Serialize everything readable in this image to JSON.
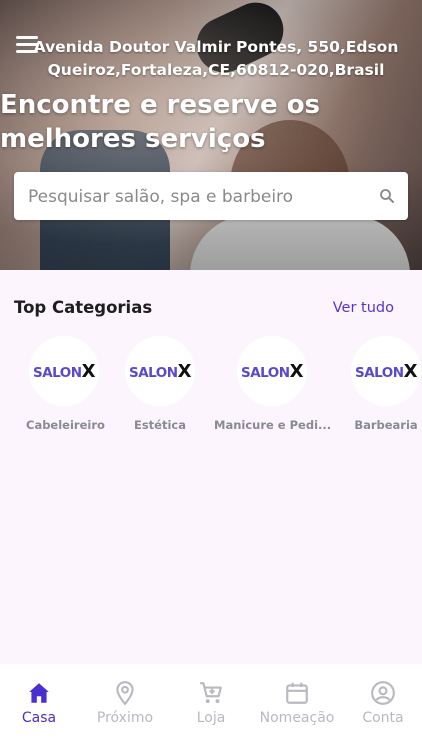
{
  "header": {
    "address": "Avenida Doutor Valmir Pontes, 550,Edson Queiroz,Fortaleza,CE,60812-020,Brasil",
    "headline": "Encontre e reserve os melhores serviços"
  },
  "search": {
    "placeholder": "Pesquisar salão, spa e barbeiro",
    "value": ""
  },
  "categories_section": {
    "title": "Top Categorias",
    "see_all": "Ver tudo",
    "items": [
      {
        "label": "Cabeleireiro",
        "logo_left": "SALON",
        "logo_right": "X"
      },
      {
        "label": "Estética",
        "logo_left": "SALON",
        "logo_right": "X"
      },
      {
        "label": "Manicure e Pedi...",
        "logo_left": "SALON",
        "logo_right": "X"
      },
      {
        "label": "Barbearia",
        "logo_left": "SALON",
        "logo_right": "X"
      }
    ]
  },
  "tabbar": {
    "items": [
      {
        "label": "Casa",
        "icon": "home-icon",
        "active": true
      },
      {
        "label": "Próximo",
        "icon": "location-pin-icon",
        "active": false
      },
      {
        "label": "Loja",
        "icon": "cart-icon",
        "active": false
      },
      {
        "label": "Nomeação",
        "icon": "calendar-icon",
        "active": false
      },
      {
        "label": "Conta",
        "icon": "account-icon",
        "active": false
      }
    ]
  },
  "colors": {
    "accent": "#4a2fd0",
    "link": "#5a34c8",
    "background": "#fdf5fd",
    "inactive_tab": "#b9b9c2"
  }
}
